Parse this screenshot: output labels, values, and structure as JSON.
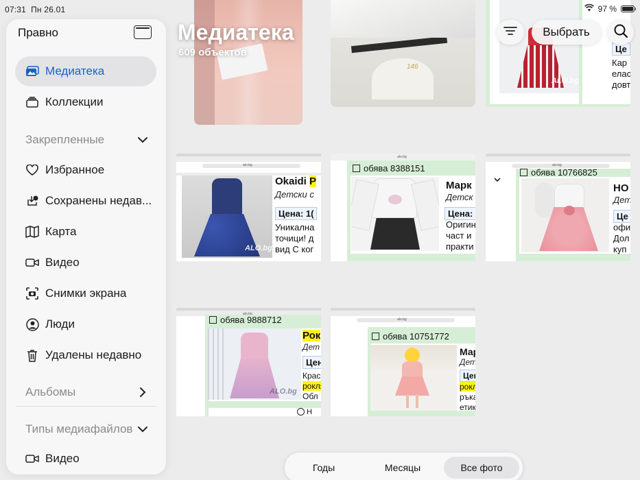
{
  "status_bar": {
    "time": "07:31",
    "date": "Пн 26.01",
    "battery": "97 %",
    "battery_level": 0.97
  },
  "sidebar": {
    "edit_label": "Правно",
    "items": [
      {
        "label": "Медиатека",
        "icon": "photos-icon",
        "active": true
      },
      {
        "label": "Коллекции",
        "icon": "collections-icon",
        "active": false
      }
    ],
    "pinned": {
      "title": "Закрепленные",
      "items": [
        {
          "label": "Избранное",
          "icon": "heart-icon"
        },
        {
          "label": "Сохранены недав...",
          "icon": "recently-saved-icon"
        },
        {
          "label": "Карта",
          "icon": "map-icon"
        },
        {
          "label": "Видео",
          "icon": "video-icon"
        },
        {
          "label": "Снимки экрана",
          "icon": "screenshot-icon"
        },
        {
          "label": "Люди",
          "icon": "person-icon"
        },
        {
          "label": "Удалены недавно",
          "icon": "trash-icon"
        }
      ]
    },
    "albums_title": "Альбомы",
    "media_types": {
      "title": "Типы медиафайлов",
      "items": [
        {
          "label": "Видео",
          "icon": "video-icon"
        }
      ]
    }
  },
  "header": {
    "title": "Медиатека",
    "subtitle": "609 объектов",
    "select_label": "Выбрать"
  },
  "tiles": {
    "t1": {
      "size_tag": "146"
    },
    "t2": {
      "ad_label": "Okaidi",
      "title": "Okaidi P",
      "subtitle": "Детски с",
      "price": "Цена: 1(",
      "lines": [
        "Уникална",
        "точици! д",
        "вид С ког"
      ],
      "watermark": "ALO.bg",
      "address": "alo.bg"
    },
    "t3": {
      "ad_label": "обява 8388151",
      "title": "Марк",
      "subtitle": "Детск",
      "price": "Цена:",
      "lines": [
        "Оригин",
        "част и",
        "практи"
      ],
      "address": "alo.bg"
    },
    "t4": {
      "ad_label": "обява 10766825",
      "title": "HO",
      "subtitle": "Дет",
      "price": "Це",
      "lines": [
        "офи",
        "Дол",
        "куп"
      ],
      "address": "alo.bg"
    },
    "t5": {
      "ad_label": "обява 9888712",
      "title": "Рок",
      "subtitle": "Дет",
      "price": "Цен",
      "lines": [
        "Крас",
        "рокля",
        "Обл"
      ],
      "footer": "Н",
      "address": "alo.bg"
    },
    "t6": {
      "ad_label": "обява 10751772",
      "title": "Мар",
      "subtitle": "Дет",
      "price": "Цен",
      "lines": [
        "рокл",
        "ръка",
        "етик"
      ],
      "address": "alo.bg"
    },
    "t7": {
      "title": "Це",
      "lines": [
        "Кар",
        "елас",
        "довт"
      ],
      "watermark": "ALO.bg"
    }
  },
  "segmented": {
    "items": [
      "Годы",
      "Месяцы",
      "Все фото"
    ],
    "active_index": 2
  },
  "colors": {
    "accent": "#1264c8",
    "green_band": "#d7eed6",
    "highlight": "#fff21a"
  }
}
